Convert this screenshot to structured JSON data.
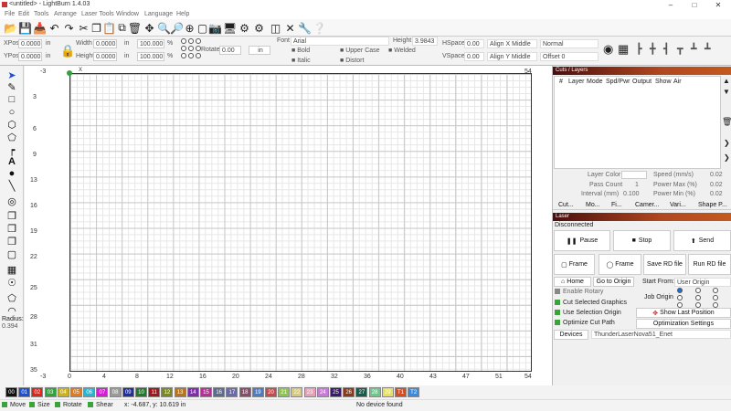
{
  "title_bar": {
    "title": "<untitled> - LightBurn 1.4.03"
  },
  "menu": [
    "File",
    "Edit",
    "Tools",
    "Arrange",
    "Laser Tools",
    "Window",
    "Language",
    "Help"
  ],
  "props": {
    "xpos_label": "XPos",
    "xpos_value": "0.0000",
    "ypos_label": "YPos",
    "ypos_value": "0.0000",
    "unit": "in",
    "width_label": "Width",
    "width_value": "0.0000",
    "height_label": "Height",
    "height_value": "0.0000",
    "pct_value": "100.000",
    "pct": "%",
    "rotate_label": "Rotate",
    "rotate_value": "0.00",
    "rotate_unit": "in",
    "font_label": "Font",
    "font_value": "Arial",
    "text_height_label": "Height",
    "text_height_value": "3.9843",
    "bold": "Bold",
    "italic": "Italic",
    "upper_case": "Upper Case",
    "distort": "Distort",
    "welded": "Welded",
    "hspace_label": "HSpace",
    "hspace_value": "0.00",
    "vspace_label": "VSpace",
    "vspace_value": "0.00",
    "align_x": "Align X Middle",
    "align_y": "Align Y Middle",
    "normal": "Normal",
    "offset": "Offset 0"
  },
  "ruler": {
    "x_ticks": [
      "0",
      "4",
      "8",
      "12",
      "16",
      "20",
      "24",
      "28",
      "32",
      "36",
      "40",
      "43",
      "47",
      "51"
    ],
    "x_top_edge": "-3",
    "x_top_end": "54",
    "x_bottom_edge": "-3",
    "x_bottom_end": "54",
    "y_ticks": [
      "3",
      "6",
      "9",
      "13",
      "16",
      "19",
      "22",
      "25",
      "28",
      "31",
      "35"
    ],
    "y_top": "-3",
    "origin_label": "X"
  },
  "radius": {
    "label": "Radius:",
    "value": "0.394"
  },
  "cuts_panel": {
    "title": "Cuts / Layers",
    "columns": [
      "#",
      "Layer",
      "Mode",
      "Spd/Pwr",
      "Output",
      "Show",
      "Air"
    ],
    "layer_color_label": "Layer Color",
    "speed_label": "Speed (mm/s)",
    "speed_value": "0.02",
    "pass_count_label": "Pass Count",
    "pass_count_value": "1",
    "power_max_label": "Power Max (%)",
    "power_max_value": "0.02",
    "interval_label": "Interval (mm)",
    "interval_value": "0.100",
    "power_min_label": "Power Min (%)",
    "power_min_value": "0.02",
    "tabs": [
      "Cut...",
      "Mo...",
      "Fi...",
      "Camer...",
      "Vari...",
      "Shape P..."
    ]
  },
  "laser_panel": {
    "title": "Laser",
    "status": "Disconnected",
    "pause": "Pause",
    "stop": "Stop",
    "send": "Send",
    "frame1": "Frame",
    "frame2": "Frame",
    "save_rd": "Save RD file",
    "run_rd": "Run RD file",
    "home": "Home",
    "go_to_origin": "Go to Origin",
    "start_from_label": "Start From:",
    "start_from_value": "User Origin",
    "enable_rotary": "Enable Rotary",
    "job_origin": "Job Origin",
    "cut_selected": "Cut Selected Graphics",
    "use_selection_origin": "Use Selection Origin",
    "show_last_position": "Show Last Position",
    "optimize_cut_path": "Optimize Cut Path",
    "optimization_settings": "Optimization Settings",
    "devices": "Devices",
    "device_value": "ThunderLaserNova51_Enet"
  },
  "palette": [
    {
      "label": "00",
      "color": "#111111"
    },
    {
      "label": "01",
      "color": "#1a4fd6"
    },
    {
      "label": "02",
      "color": "#e0231b"
    },
    {
      "label": "03",
      "color": "#2fa43a"
    },
    {
      "label": "04",
      "color": "#c9b21c"
    },
    {
      "label": "05",
      "color": "#e07a1d"
    },
    {
      "label": "06",
      "color": "#23b7d4"
    },
    {
      "label": "07",
      "color": "#d61ad6"
    },
    {
      "label": "08",
      "color": "#9a9a9a"
    },
    {
      "label": "09",
      "color": "#1f2fa0"
    },
    {
      "label": "10",
      "color": "#1f7a2a"
    },
    {
      "label": "11",
      "color": "#a0161a"
    },
    {
      "label": "12",
      "color": "#7c8a1c"
    },
    {
      "label": "13",
      "color": "#b8731d"
    },
    {
      "label": "14",
      "color": "#7d2fa8"
    },
    {
      "label": "15",
      "color": "#b82f9a"
    },
    {
      "label": "16",
      "color": "#5b6d8a"
    },
    {
      "label": "17",
      "color": "#6a6aa8"
    },
    {
      "label": "18",
      "color": "#8a4a6a"
    },
    {
      "label": "19",
      "color": "#4a7dc8"
    },
    {
      "label": "20",
      "color": "#c84a4a"
    },
    {
      "label": "21",
      "color": "#8ac84a"
    },
    {
      "label": "22",
      "color": "#d8c87a"
    },
    {
      "label": "23",
      "color": "#e8a0b8"
    },
    {
      "label": "24",
      "color": "#c87ad8"
    },
    {
      "label": "25",
      "color": "#3a1a6a"
    },
    {
      "label": "26",
      "color": "#8a3a1a"
    },
    {
      "label": "27",
      "color": "#1a5a4a"
    },
    {
      "label": "28",
      "color": "#6ac88a"
    },
    {
      "label": "29",
      "color": "#e8e05a"
    },
    {
      "label": "T1",
      "color": "#e04a1a"
    },
    {
      "label": "T2",
      "color": "#3a8ae0"
    }
  ],
  "status": {
    "move": "Move",
    "size": "Size",
    "rotate": "Rotate",
    "shear": "Shear",
    "coords": "x: -4.687, y: 10.619 in",
    "device": "No device found"
  }
}
